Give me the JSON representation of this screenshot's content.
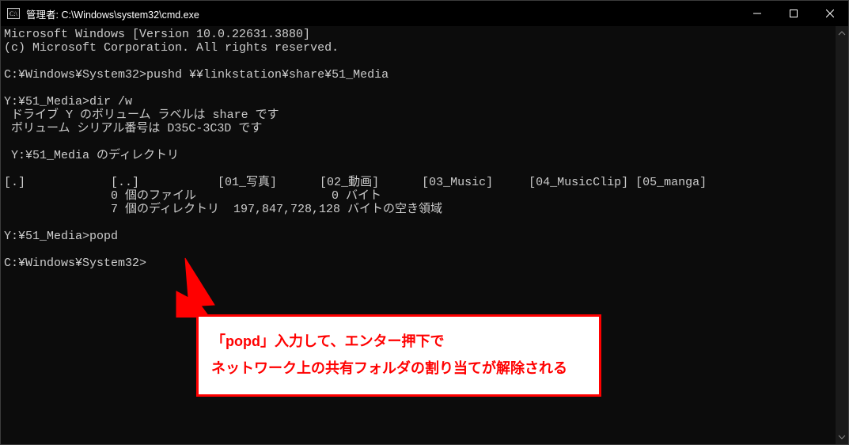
{
  "window": {
    "title": "管理者: C:\\Windows\\system32\\cmd.exe"
  },
  "terminal": {
    "lines": [
      "Microsoft Windows [Version 10.0.22631.3880]",
      "(c) Microsoft Corporation. All rights reserved.",
      "",
      "C:¥Windows¥System32>pushd ¥¥linkstation¥share¥51_Media",
      "",
      "Y:¥51_Media>dir /w",
      " ドライブ Y のボリューム ラベルは share です",
      " ボリューム シリアル番号は D35C-3C3D です",
      "",
      " Y:¥51_Media のディレクトリ",
      "",
      "[.]            [..]           [01_写真]      [02_動画]      [03_Music]     [04_MusicClip] [05_manga]",
      "               0 個のファイル                   0 バイト",
      "               7 個のディレクトリ  197,847,728,128 バイトの空き領域",
      "",
      "Y:¥51_Media>popd",
      "",
      "C:¥Windows¥System32>"
    ]
  },
  "callout": {
    "line1": "「popd」入力して、エンター押下で",
    "line2": "ネットワーク上の共有フォルダの割り当てが解除される"
  },
  "icons": {
    "minimize": "—",
    "maximize": "□",
    "close": "✕",
    "scroll_up": "˄",
    "scroll_down": "˅"
  }
}
